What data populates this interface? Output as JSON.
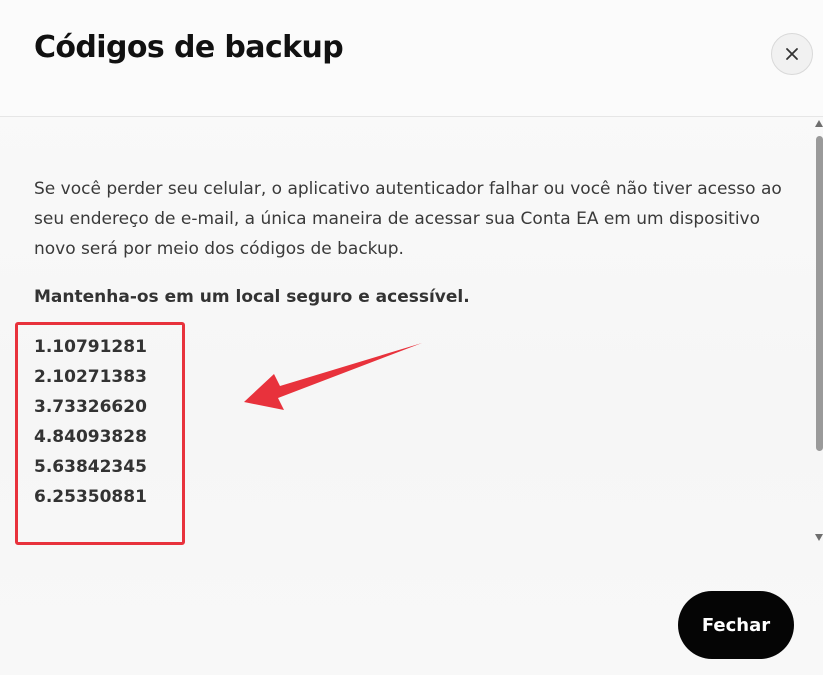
{
  "dialog": {
    "title": "Códigos de backup",
    "close_label": "×",
    "description": "Se você perder seu celular, o aplicativo autenticador falhar ou você não tiver acesso ao seu endereço de e-mail, a única maneira de acessar sua Conta EA em um dispositivo novo será por meio dos códigos de backup.",
    "emphasis": "Mantenha-os em um local seguro e acessível.",
    "codes": [
      "1.10791281",
      "2.10271383",
      "3.73326620",
      "4.84093828",
      "5.63842345",
      "6.25350881"
    ],
    "primary_button_label": "Fechar"
  },
  "icons": {
    "close": "close-icon",
    "annotation_arrow": "arrow-icon",
    "scroll_up": "chevron-up-icon",
    "scroll_down": "chevron-down-icon"
  },
  "colors": {
    "annotation": "#e8323c",
    "primary_button": "#050505",
    "title": "#111111"
  }
}
